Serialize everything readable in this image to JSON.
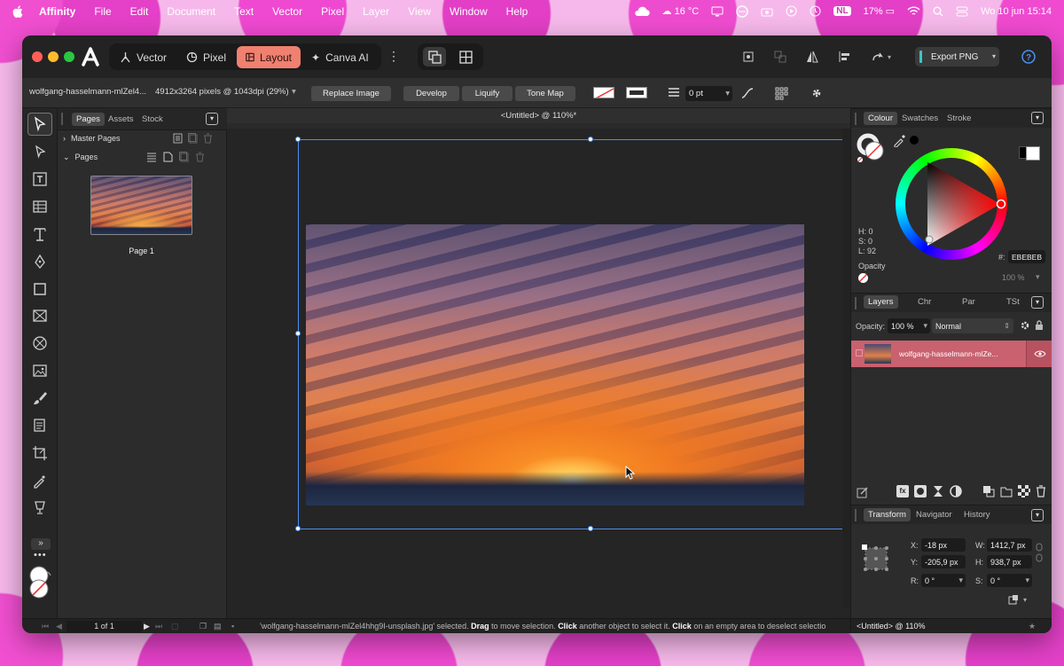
{
  "menubar": {
    "apple": "",
    "app": "Affinity",
    "items": [
      "File",
      "Edit",
      "Document",
      "Text",
      "Vector",
      "Pixel",
      "Layer",
      "View",
      "Window",
      "Help"
    ],
    "weather": "16 °C",
    "lang": "NL",
    "battery": "17%",
    "datetime": "Wo 10 jun  15:14"
  },
  "studios": {
    "vector": "Vector",
    "pixel": "Pixel",
    "layout": "Layout",
    "canva": "Canva AI"
  },
  "export": {
    "label": "Export PNG"
  },
  "context": {
    "filename": "wolfgang-hasselmann-mlZel4...",
    "dimensions": "4912x3264 pixels @ 1043dpi (29%)",
    "replace": "Replace Image",
    "develop": "Develop",
    "liquify": "Liquify",
    "tonemap": "Tone Map",
    "stroke_width": "0 pt"
  },
  "pages_panel": {
    "tabs": [
      "Pages",
      "Assets",
      "Stock"
    ],
    "master_pages": "Master Pages",
    "pages": "Pages",
    "page1": "Page 1"
  },
  "canvas": {
    "title": "<Untitled> @ 110%*"
  },
  "colour_panel": {
    "tabs": [
      "Colour",
      "Swatches",
      "Stroke"
    ],
    "h": "H: 0",
    "s": "S: 0",
    "l": "L: 92",
    "hex_label": "#:",
    "hex": "EBEBEB",
    "opacity_label": "Opacity",
    "opacity_value": "100 %"
  },
  "layers_panel": {
    "tabs": [
      "Layers",
      "Chr",
      "Par",
      "TSt"
    ],
    "opacity_label": "Opacity:",
    "opacity_value": "100 %",
    "blend": "Normal",
    "layer_name": "wolfgang-hasselmann-mlZe..."
  },
  "transform_panel": {
    "tabs": [
      "Transform",
      "Navigator",
      "History"
    ],
    "x_label": "X:",
    "x": "-18 px",
    "w_label": "W:",
    "w": "1412,7 px",
    "y_label": "Y:",
    "y": "-205,9 px",
    "h_label": "H:",
    "h": "938,7 px",
    "r_label": "R:",
    "r": "0 °",
    "s_label": "S:",
    "s": "0 °"
  },
  "status": {
    "page": "1 of 1",
    "msg_name": "'wolfgang-hasselmann-mlZel4hhg9I-unsplash.jpg' selected.",
    "msg_drag": "Drag",
    "msg_1": "to move selection.",
    "msg_click": "Click",
    "msg_2": "another object to select it.",
    "msg_click2": "Click",
    "msg_3": "on an empty area to deselect selectio",
    "doc": "<Untitled> @ 110%"
  },
  "colors": {
    "accent": "#f08070",
    "selection": "#4a8ff0",
    "layer_selected": "#c9616f"
  }
}
